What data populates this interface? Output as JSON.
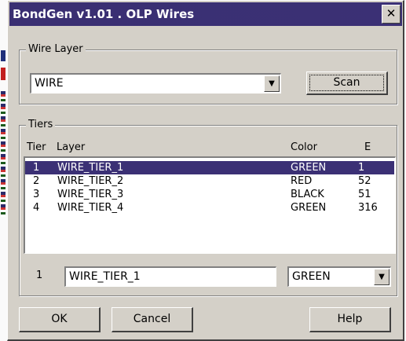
{
  "window": {
    "title": "BondGen v1.01 . OLP Wires",
    "close_glyph": "✕"
  },
  "wire_layer": {
    "group_label": "Wire Layer",
    "selected": "WIRE",
    "scan_label": "Scan"
  },
  "tiers": {
    "group_label": "Tiers",
    "columns": [
      "Tier",
      "Layer",
      "Color",
      "E"
    ],
    "rows": [
      {
        "tier": "1",
        "layer": "WIRE_TIER_1",
        "color": "GREEN",
        "e": "1",
        "selected": true
      },
      {
        "tier": "2",
        "layer": "WIRE_TIER_2",
        "color": "RED",
        "e": "52",
        "selected": false
      },
      {
        "tier": "3",
        "layer": "WIRE_TIER_3",
        "color": "BLACK",
        "e": "51",
        "selected": false
      },
      {
        "tier": "4",
        "layer": "WIRE_TIER_4",
        "color": "GREEN",
        "e": "316",
        "selected": false
      }
    ],
    "edit": {
      "tier": "1",
      "layer_value": "WIRE_TIER_1",
      "color_value": "GREEN"
    }
  },
  "buttons": {
    "ok": "OK",
    "cancel": "Cancel",
    "help": "Help"
  },
  "colors": {
    "dialog_face": "#d4d0c8",
    "titlebar": "#3b3075",
    "selection": "#3b3075"
  },
  "icons": {
    "dropdown": "chevron-down-icon",
    "close": "close-icon"
  }
}
